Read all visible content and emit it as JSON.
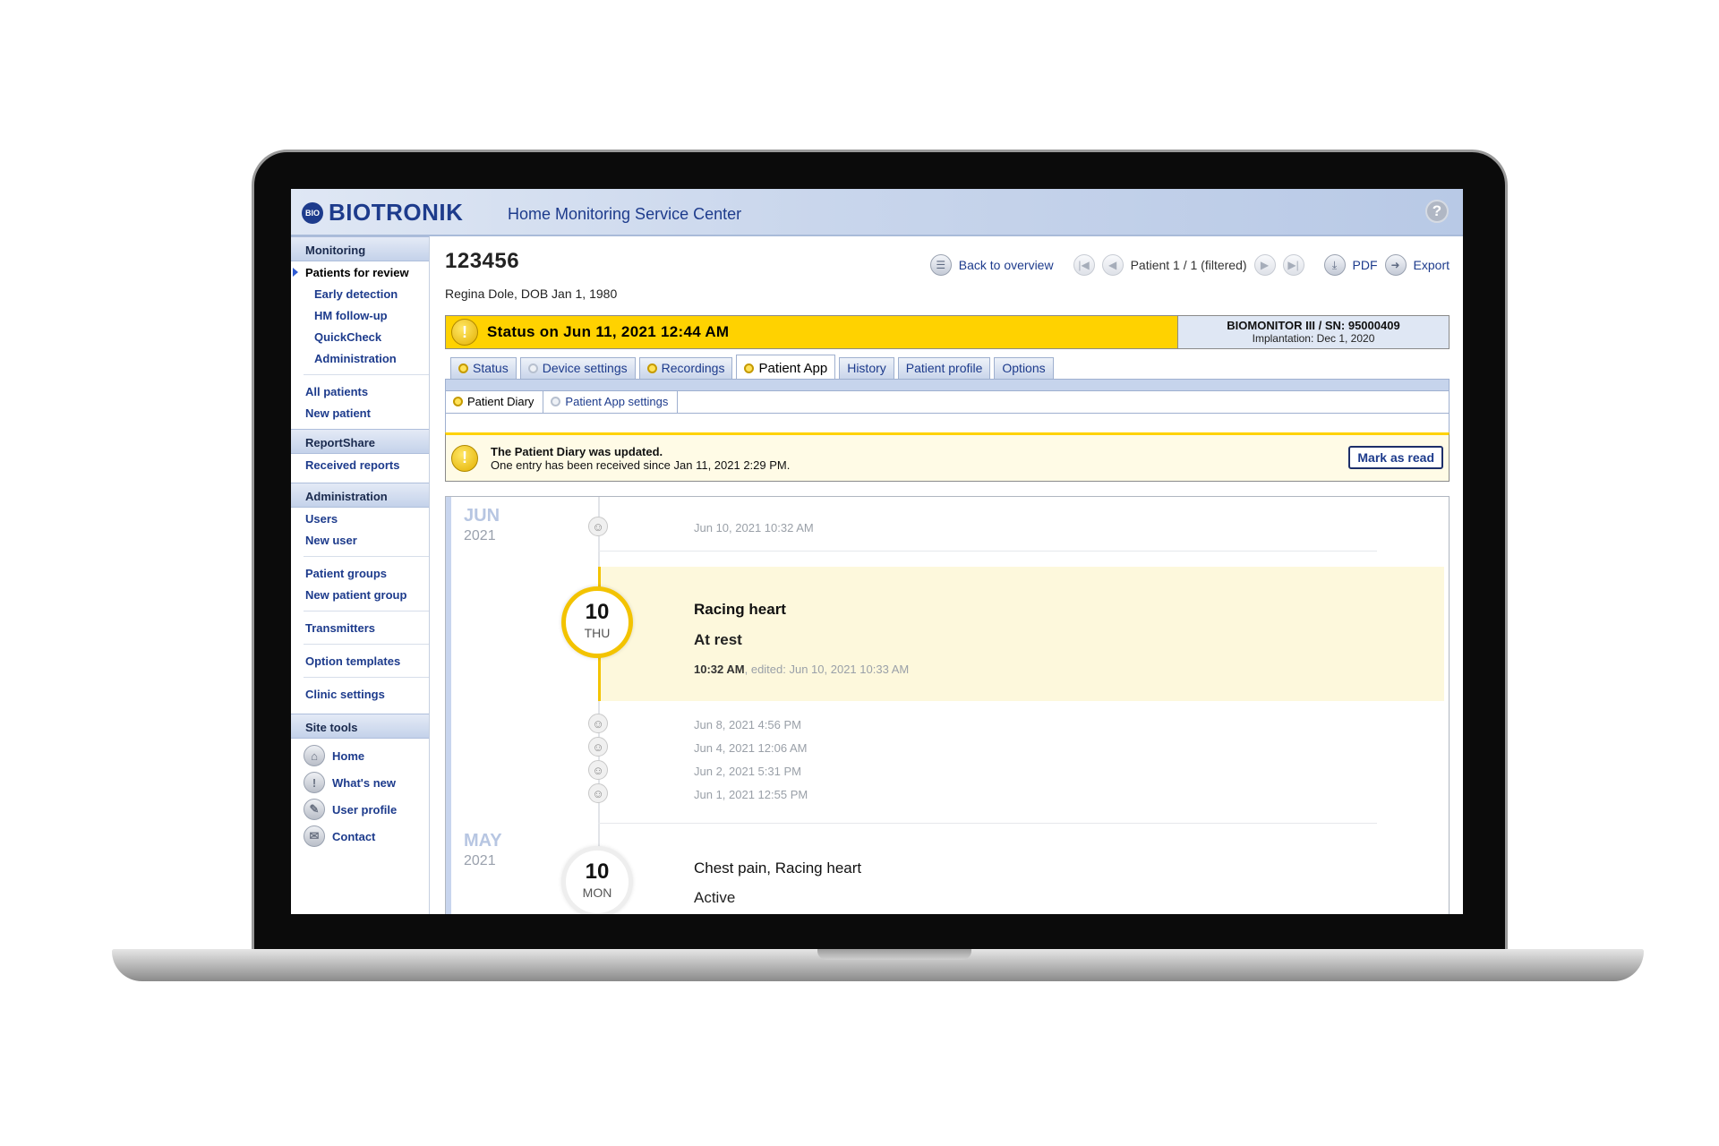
{
  "header": {
    "logo_mark": "BIO",
    "logo_text": "BIOTRONIK",
    "app_title": "Home Monitoring Service Center",
    "help": "?"
  },
  "sidebar": {
    "monitoring_title": "Monitoring",
    "monitoring_items": [
      "Patients for review",
      "Early detection",
      "HM follow-up",
      "QuickCheck",
      "Administration"
    ],
    "patient_items": [
      "All patients",
      "New patient"
    ],
    "reportshare_title": "ReportShare",
    "reportshare_items": [
      "Received reports"
    ],
    "administration_title": "Administration",
    "admin_items_a": [
      "Users",
      "New user"
    ],
    "admin_items_b": [
      "Patient groups",
      "New patient group"
    ],
    "admin_items_c": [
      "Transmitters"
    ],
    "admin_items_d": [
      "Option templates"
    ],
    "admin_items_e": [
      "Clinic settings"
    ],
    "site_tools_title": "Site tools",
    "site_tools": [
      {
        "label": "Home",
        "icon": "home-icon"
      },
      {
        "label": "What's new",
        "icon": "info-exclamation-icon"
      },
      {
        "label": "User profile",
        "icon": "pencil-icon"
      },
      {
        "label": "Contact",
        "icon": "envelope-icon"
      }
    ]
  },
  "patient": {
    "id": "123456",
    "name_line": "Regina Dole, DOB Jan 1, 1980"
  },
  "actions": {
    "back": "Back to overview",
    "pager": "Patient 1 / 1 (filtered)",
    "pdf": "PDF",
    "export": "Export"
  },
  "status": {
    "text": "Status on Jun 11, 2021 12:44 AM",
    "device": "BIOMONITOR III / SN: 95000409",
    "implantation": "Implantation: Dec 1, 2020",
    "color": "#ffd200"
  },
  "tabs": [
    "Status",
    "Device settings",
    "Recordings",
    "Patient App",
    "History",
    "Patient profile",
    "Options"
  ],
  "subtabs": [
    "Patient Diary",
    "Patient App settings"
  ],
  "notice": {
    "title": "The Patient Diary was updated.",
    "body": "One entry has been received since Jan 11, 2021 2:29 PM.",
    "button": "Mark as read"
  },
  "diary": {
    "jun": {
      "month": "JUN",
      "year": "2021"
    },
    "entries_top": [
      "Jun 10, 2021 10:32 AM"
    ],
    "highlight": {
      "day": "10",
      "weekday": "THU",
      "title": "Racing heart",
      "subtitle": "At rest",
      "time": "10:32 AM",
      "edited": ", edited: Jun 10, 2021 10:33 AM"
    },
    "entries_after": [
      "Jun 8, 2021 4:56 PM",
      "Jun 4, 2021 12:06 AM",
      "Jun 2, 2021 5:31 PM",
      "Jun 1, 2021 12:55 PM"
    ],
    "may": {
      "month": "MAY",
      "year": "2021",
      "day": "10",
      "weekday": "MON",
      "title": "Chest pain, Racing heart",
      "subtitle": "Active"
    }
  }
}
